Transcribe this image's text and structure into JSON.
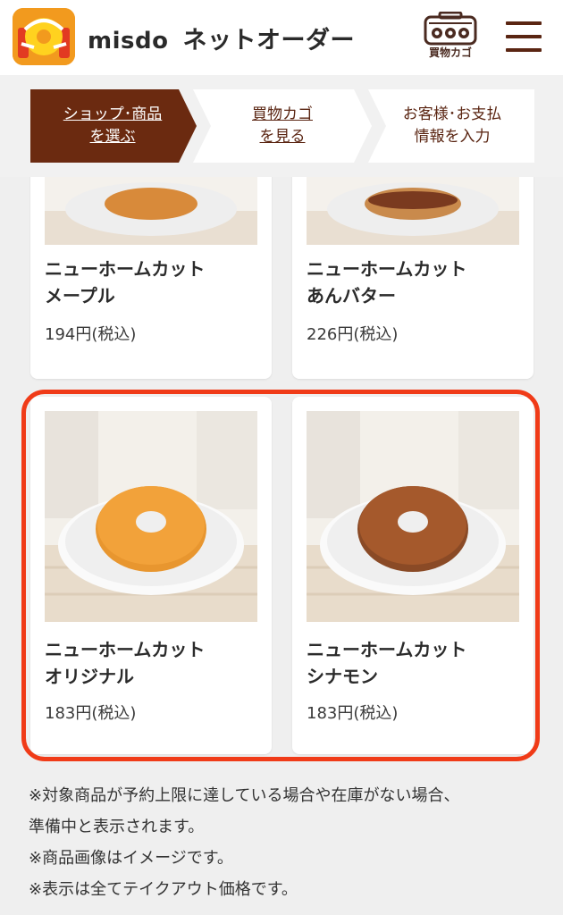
{
  "header": {
    "brand": "misdo",
    "brand_sub": "ネットオーダー",
    "cart_label": "買物カゴ",
    "colors": {
      "brand_orange": "#f29a1e",
      "brown": "#5a2512",
      "highlight": "#f03b18"
    }
  },
  "steps": [
    {
      "line1": "ショップ･商品",
      "line2": "を選ぶ",
      "active": true
    },
    {
      "line1": "買物カゴ",
      "line2": "を見る",
      "active": false
    },
    {
      "line1": "お客様･お支払",
      "line2": "情報を入力",
      "active": false
    }
  ],
  "products": [
    {
      "name_line1": "ニューホームカット",
      "name_line2": "メープル",
      "price": "194円(税込)"
    },
    {
      "name_line1": "ニューホームカット",
      "name_line2": "あんバター",
      "price": "226円(税込)"
    },
    {
      "name_line1": "ニューホームカット",
      "name_line2": "オリジナル",
      "price": "183円(税込)"
    },
    {
      "name_line1": "ニューホームカット",
      "name_line2": "シナモン",
      "price": "183円(税込)"
    }
  ],
  "notes": [
    "※対象商品が予約上限に達している場合や在庫がない場合、",
    "準備中と表示されます。",
    "※商品画像はイメージです。",
    "※表示は全てテイクアウト価格です。"
  ]
}
